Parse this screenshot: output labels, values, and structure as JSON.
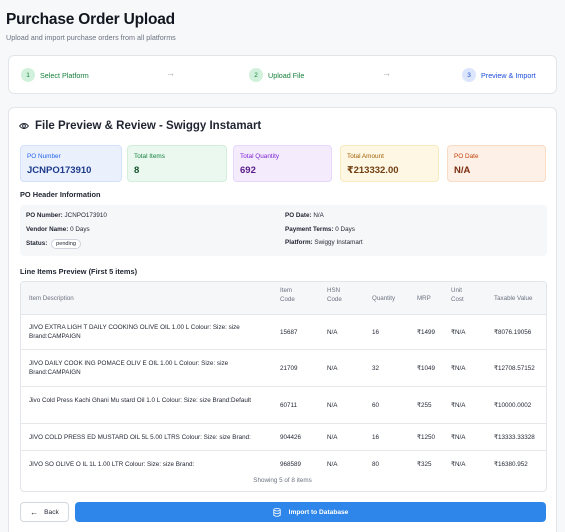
{
  "header": {
    "title": "Purchase Order Upload",
    "subtitle": "Upload and import purchase orders from all platforms"
  },
  "steps": [
    {
      "num": "1",
      "label": "Select Platform",
      "state": "done"
    },
    {
      "num": "2",
      "label": "Upload File",
      "state": "done"
    },
    {
      "num": "3",
      "label": "Preview & Import",
      "state": "current"
    }
  ],
  "preview": {
    "title": "File Preview & Review - Swiggy Instamart",
    "stats": [
      {
        "label": "PO Number",
        "value": "JCNPO173910"
      },
      {
        "label": "Total Items",
        "value": "8"
      },
      {
        "label": "Total Quantity",
        "value": "692"
      },
      {
        "label": "Total Amount",
        "value": "₹213332.00"
      },
      {
        "label": "PO Date",
        "value": "N/A"
      }
    ]
  },
  "po_header": {
    "section_title": "PO Header Information",
    "po_number_label": "PO Number:",
    "po_number": "JCNPO173910",
    "vendor_name_label": "Vendor Name:",
    "vendor_name": "0 Days",
    "status_label": "Status:",
    "status": "pending",
    "po_date_label": "PO Date:",
    "po_date": "N/A",
    "payment_terms_label": "Payment Terms:",
    "payment_terms": "0 Days",
    "platform_label": "Platform:",
    "platform": "Swiggy Instamart"
  },
  "line_items": {
    "section_title": "Line Items Preview (First 5 items)",
    "columns": {
      "desc": "Item Description",
      "code": "Item Code",
      "hsn": "HSN Code",
      "qty": "Quantity",
      "mrp": "MRP",
      "unit": "Unit Cost",
      "taxable": "Taxable Value"
    },
    "rows": [
      {
        "desc": "JIVO EXTRA LIGH T DAILY COOKING OLIVE OIL 1.00 L Colour: Size: size Brand:CAMPAIGN",
        "code": "15687",
        "hsn": "N/A",
        "qty": "16",
        "mrp": "₹1499",
        "unit": "₹N/A",
        "taxable": "₹8076.19056"
      },
      {
        "desc": "JIVO DAILY COOK ING POMACE OLIV E OIL 1.00 L Colour: Size: size Brand:CAMPAIGN",
        "code": "21709",
        "hsn": "N/A",
        "qty": "32",
        "mrp": "₹1049",
        "unit": "₹N/A",
        "taxable": "₹12708.57152"
      },
      {
        "desc": "Jivo Cold Press Kachi Ghani Mu stard Oil 1.0 L Colour: Size: size Brand:Default",
        "code": "60711",
        "hsn": "N/A",
        "qty": "60",
        "mrp": "₹255",
        "unit": "₹N/A",
        "taxable": "₹10000.0002"
      },
      {
        "desc": "JIVO COLD PRESS ED MUSTARD OIL 5L 5.00 LTRS Colour: Size: size Brand:",
        "code": "904426",
        "hsn": "N/A",
        "qty": "16",
        "mrp": "₹1250",
        "unit": "₹N/A",
        "taxable": "₹13333.33328"
      },
      {
        "desc": "JIVO SO OLIVE O IL 1L 1.00 LTR Colour: Size: size Brand:",
        "code": "968589",
        "hsn": "N/A",
        "qty": "80",
        "mrp": "₹325",
        "unit": "₹N/A",
        "taxable": "₹16380.952"
      }
    ],
    "showing": "Showing 5 of 8 items"
  },
  "actions": {
    "back": "Back",
    "import": "Import to Database"
  }
}
